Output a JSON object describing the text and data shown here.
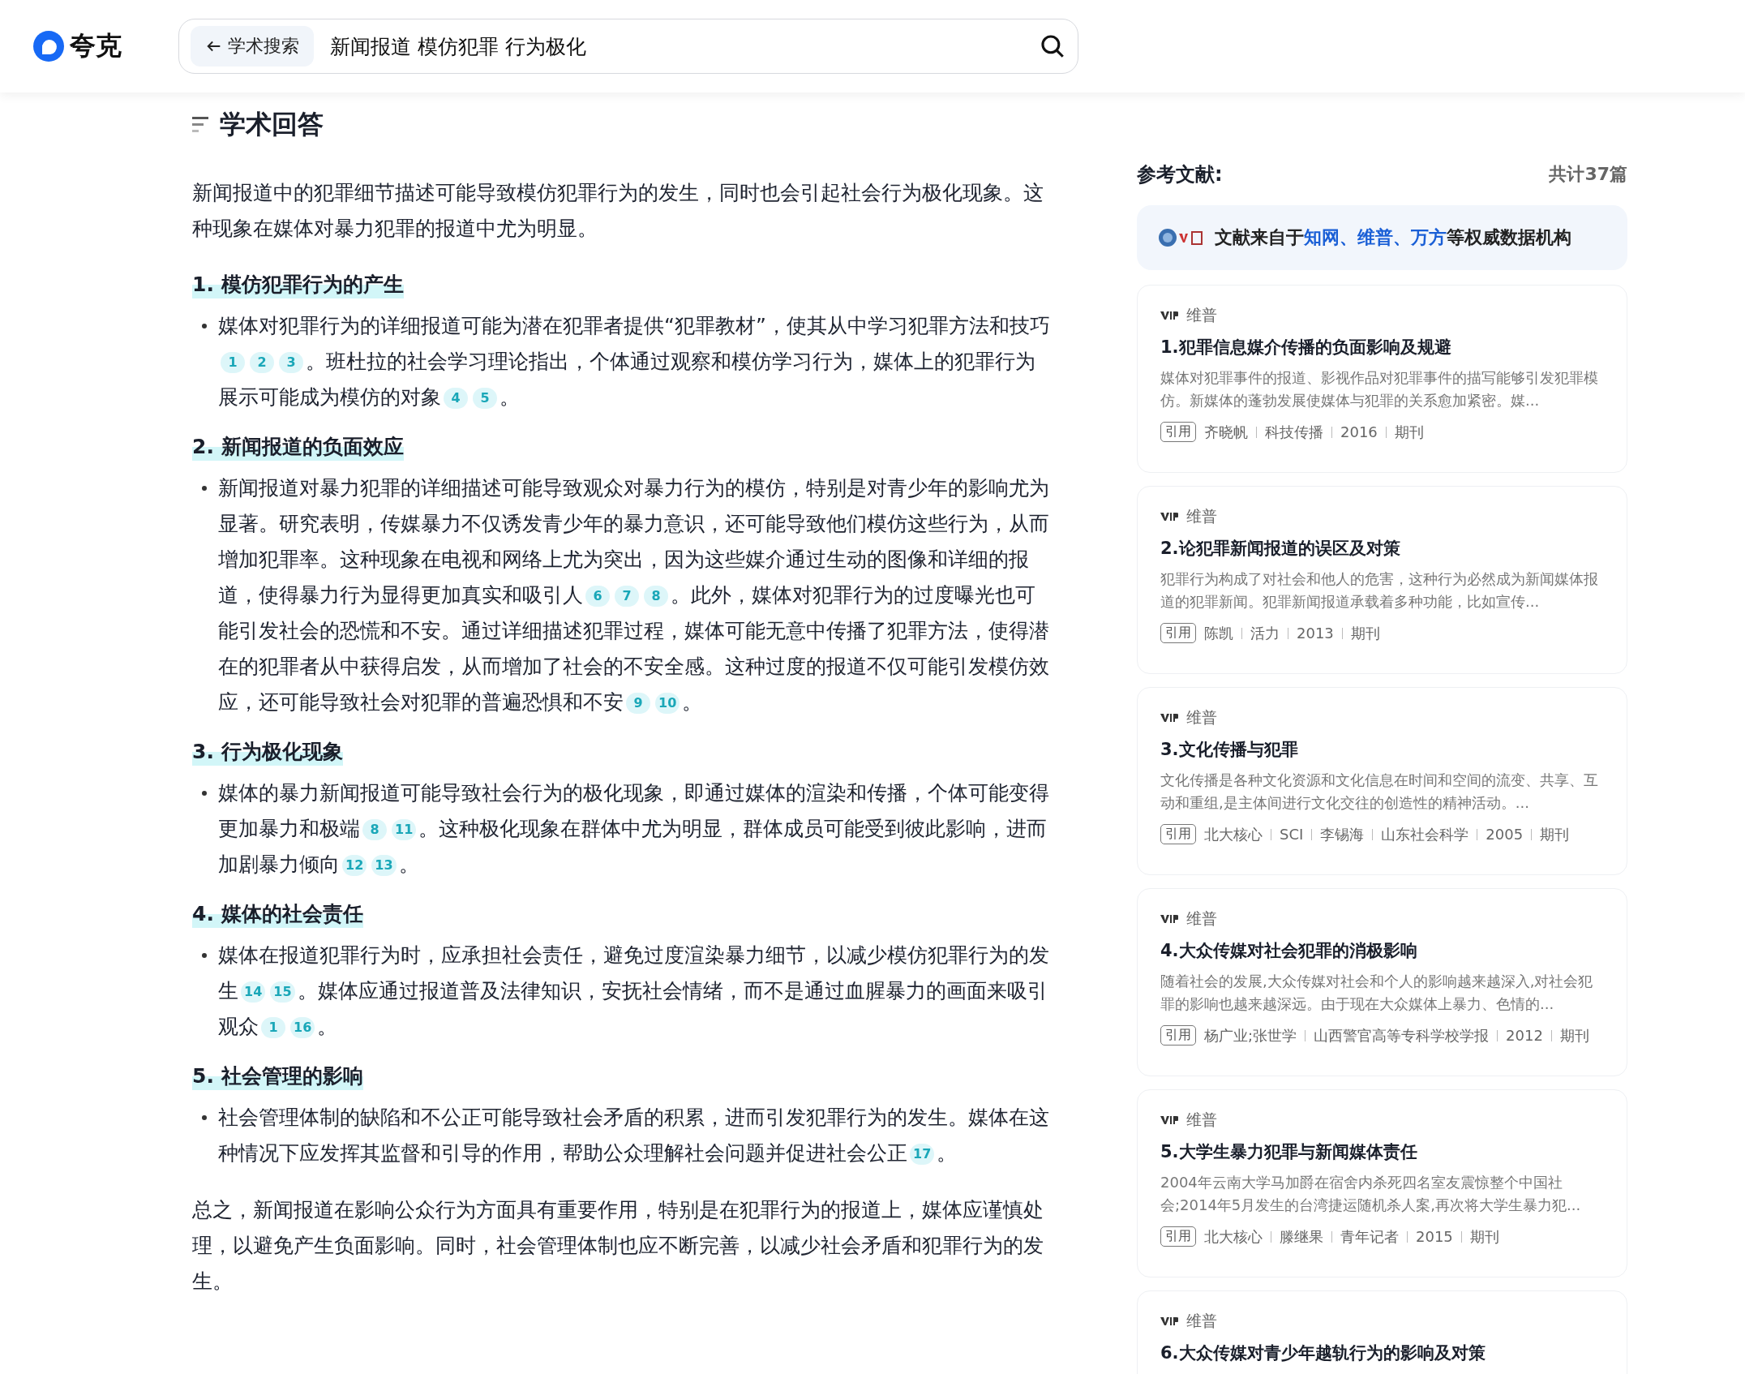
{
  "header": {
    "logo": "夸克",
    "back_button": "学术搜索",
    "query": "新闻报道 模仿犯罪 行为极化"
  },
  "answer": {
    "title": "学术回答",
    "intro": "新闻报道中的犯罪细节描述可能导致模仿犯罪行为的发生，同时也会引起社会行为极化现象。这种现象在媒体对暴力犯罪的报道中尤为明显。",
    "sections": [
      {
        "heading": "1. 模仿犯罪行为的产生",
        "parts": [
          {
            "text": "媒体对犯罪行为的详细报道可能为潜在犯罪者提供“犯罪教材”，使其从中学习犯罪方法和技巧"
          },
          {
            "cites": [
              "1",
              "2",
              "3"
            ]
          },
          {
            "text": "。班杜拉的社会学习理论指出，个体通过观察和模仿学习行为，媒体上的犯罪行为展示可能成为模仿的对象"
          },
          {
            "cites": [
              "4",
              "5"
            ]
          },
          {
            "text": "。"
          }
        ]
      },
      {
        "heading": "2. 新闻报道的负面效应",
        "parts": [
          {
            "text": "新闻报道对暴力犯罪的详细描述可能导致观众对暴力行为的模仿，特别是对青少年的影响尤为显著。研究表明，传媒暴力不仅诱发青少年的暴力意识，还可能导致他们模仿这些行为，从而增加犯罪率。这种现象在电视和网络上尤为突出，因为这些媒介通过生动的图像和详细的报道，使得暴力行为显得更加真实和吸引人"
          },
          {
            "cites": [
              "6",
              "7",
              "8"
            ]
          },
          {
            "text": "。此外，媒体对犯罪行为的过度曝光也可能引发社会的恐慌和不安。通过详细描述犯罪过程，媒体可能无意中传播了犯罪方法，使得潜在的犯罪者从中获得启发，从而增加了社会的不安全感。这种过度的报道不仅可能引发模仿效应，还可能导致社会对犯罪的普遍恐惧和不安"
          },
          {
            "cites": [
              "9",
              "10"
            ]
          },
          {
            "text": "。"
          }
        ]
      },
      {
        "heading": "3. 行为极化现象",
        "parts": [
          {
            "text": "媒体的暴力新闻报道可能导致社会行为的极化现象，即通过媒体的渲染和传播，个体可能变得更加暴力和极端"
          },
          {
            "cites": [
              "8",
              "11"
            ]
          },
          {
            "text": "。这种极化现象在群体中尤为明显，群体成员可能受到彼此影响，进而加剧暴力倾向"
          },
          {
            "cites": [
              "12",
              "13"
            ]
          },
          {
            "text": "。"
          }
        ]
      },
      {
        "heading": "4. 媒体的社会责任",
        "parts": [
          {
            "text": "媒体在报道犯罪行为时，应承担社会责任，避免过度渲染暴力细节，以减少模仿犯罪行为的发生"
          },
          {
            "cites": [
              "14",
              "15"
            ]
          },
          {
            "text": "。媒体应通过报道普及法律知识，安抚社会情绪，而不是通过血腥暴力的画面来吸引观众"
          },
          {
            "cites": [
              "1",
              "16"
            ]
          },
          {
            "text": "。"
          }
        ]
      },
      {
        "heading": "5. 社会管理的影响",
        "parts": [
          {
            "text": "社会管理体制的缺陷和不公正可能导致社会矛盾的积累，进而引发犯罪行为的发生。媒体在这种情况下应发挥其监督和引导的作用，帮助公众理解社会问题并促进社会公正"
          },
          {
            "cites": [
              "17"
            ]
          },
          {
            "text": "。"
          }
        ]
      }
    ],
    "conclusion": "总之，新闻报道在影响公众行为方面具有重要作用，特别是在犯罪行为的报道上，媒体应谨慎处理，以避免产生负面影响。同时，社会管理体制也应不断完善，以减少社会矛盾和犯罪行为的发生。"
  },
  "references": {
    "title": "参考文献:",
    "count": "共计37篇",
    "source_banner": [
      {
        "text": "文献来自于",
        "link": false
      },
      {
        "text": "知网、维普、万方",
        "link": true
      },
      {
        "text": "等权威数据机构",
        "link": false
      }
    ],
    "items": [
      {
        "source": "维普",
        "title": "1.犯罪信息媒介传播的负面影响及规避",
        "abstract": "媒体对犯罪事件的报道、影视作品对犯罪事件的描写能够引发犯罪模仿。新媒体的蓬勃发展使媒体与犯罪的关系愈加紧密。媒...",
        "cite": "引用",
        "meta": [
          "齐晓帆",
          "科技传播",
          "2016",
          "期刊"
        ]
      },
      {
        "source": "维普",
        "title": "2.论犯罪新闻报道的误区及对策",
        "abstract": "犯罪行为构成了对社会和他人的危害，这种行为必然成为新闻媒体报道的犯罪新闻。犯罪新闻报道承载着多种功能，比如宣传...",
        "cite": "引用",
        "meta": [
          "陈凯",
          "活力",
          "2013",
          "期刊"
        ]
      },
      {
        "source": "维普",
        "title": "3.文化传播与犯罪",
        "abstract": "文化传播是各种文化资源和文化信息在时间和空间的流变、共享、互动和重组,是主体间进行文化交往的创造性的精神活动。...",
        "cite": "引用",
        "meta": [
          "北大核心",
          "SCI",
          "李锡海",
          "山东社会科学",
          "2005",
          "期刊"
        ]
      },
      {
        "source": "维普",
        "title": "4.大众传媒对社会犯罪的消极影响",
        "abstract": "随着社会的发展,大众传媒对社会和个人的影响越来越深入,对社会犯罪的影响也越来越深远。由于现在大众媒体上暴力、色情的...",
        "cite": "引用",
        "meta": [
          "杨广业;张世学",
          "山西警官高等专科学校学报",
          "2012",
          "期刊"
        ]
      },
      {
        "source": "维普",
        "title": "5.大学生暴力犯罪与新闻媒体责任",
        "abstract": "2004年云南大学马加爵在宿舍内杀死四名室友震惊整个中国社会;2014年5月发生的台湾捷运随机杀人案,再次将大学生暴力犯...",
        "cite": "引用",
        "meta": [
          "北大核心",
          "滕继果",
          "青年记者",
          "2015",
          "期刊"
        ]
      },
      {
        "source": "维普",
        "title": "6.大众传媒对青少年越轨行为的影响及对策"
      }
    ]
  }
}
